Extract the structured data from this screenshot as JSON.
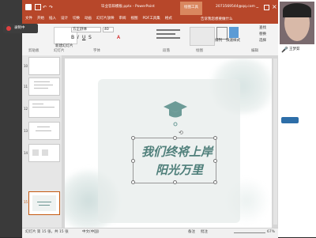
{
  "title_bar": {
    "document_title": "毕业答辩模板.pptx - PowerPoint",
    "context_tab": "绘图工具",
    "user_email": "2073569544@qq.com",
    "logo_icon": "powerpoint-icon",
    "accent": "#b7472a"
  },
  "ribbon_tabs": [
    "文件",
    "开始",
    "插入",
    "设计",
    "切换",
    "动画",
    "幻灯片放映",
    "审阅",
    "视图",
    "PDF工具集",
    "格式"
  ],
  "ribbon": {
    "tell_me": "告诉我您想要做什么",
    "font_name": "方正舒体",
    "font_size": "40",
    "new_slide": "新建幻灯片",
    "group_labels": [
      "剪贴板",
      "幻灯片",
      "字体",
      "段落",
      "绘图",
      "编辑"
    ],
    "arrange": "排列",
    "quick_styles": "快速样式",
    "find": "查找",
    "replace": "替换",
    "select": "选择"
  },
  "recording": {
    "label": "录制中",
    "icon": "record-icon"
  },
  "slide": {
    "line1": "我们终将上岸",
    "line2": "阳光万里",
    "icon": "graduation-cap-icon",
    "accent": "#5d8a88"
  },
  "thumbnails": [
    {
      "num": "10"
    },
    {
      "num": "11"
    },
    {
      "num": "12"
    },
    {
      "num": "13"
    },
    {
      "num": "14"
    },
    {
      "num": "15"
    }
  ],
  "status_bar": {
    "slide_count": "幻灯片 第 15 张，共 15 张",
    "language": "中文(中国)",
    "notes": "备注",
    "comments": "批注",
    "zoom": "67%"
  },
  "participant": {
    "name": "王梦茹",
    "mic_icon": "microphone-icon"
  }
}
